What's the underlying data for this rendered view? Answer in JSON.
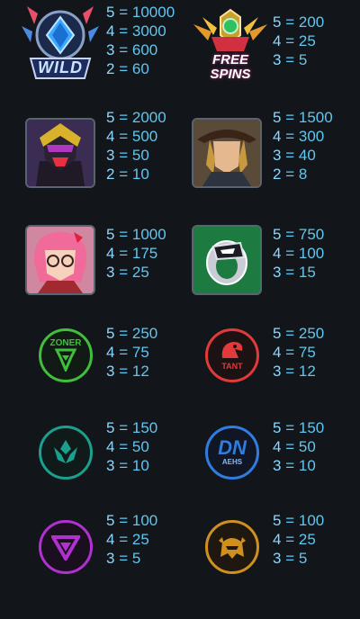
{
  "paytable": [
    {
      "symbol": "wild",
      "icon": "wild-logo-icon",
      "label": "WILD",
      "pays": [
        {
          "count": "5",
          "value": "10000"
        },
        {
          "count": "4",
          "value": "3000"
        },
        {
          "count": "3",
          "value": "600"
        },
        {
          "count": "2",
          "value": "60"
        }
      ]
    },
    {
      "symbol": "free-spins",
      "icon": "free-spins-logo-icon",
      "label": "FREE SPINS",
      "pays": [
        {
          "count": "5",
          "value": "200"
        },
        {
          "count": "4",
          "value": "25"
        },
        {
          "count": "3",
          "value": "5"
        }
      ]
    },
    {
      "symbol": "masked-hero",
      "icon": "masked-hero-portrait-icon",
      "pays": [
        {
          "count": "5",
          "value": "2000"
        },
        {
          "count": "4",
          "value": "500"
        },
        {
          "count": "3",
          "value": "50"
        },
        {
          "count": "2",
          "value": "10"
        }
      ]
    },
    {
      "symbol": "cowboy-hero",
      "icon": "cowboy-hero-portrait-icon",
      "pays": [
        {
          "count": "5",
          "value": "1500"
        },
        {
          "count": "4",
          "value": "300"
        },
        {
          "count": "3",
          "value": "40"
        },
        {
          "count": "2",
          "value": "8"
        }
      ]
    },
    {
      "symbol": "pink-hair-girl",
      "icon": "pink-hair-girl-portrait-icon",
      "pays": [
        {
          "count": "5",
          "value": "1000"
        },
        {
          "count": "4",
          "value": "175"
        },
        {
          "count": "3",
          "value": "25"
        }
      ]
    },
    {
      "symbol": "dragon-ring",
      "icon": "dragon-ring-icon",
      "pays": [
        {
          "count": "5",
          "value": "750"
        },
        {
          "count": "4",
          "value": "100"
        },
        {
          "count": "3",
          "value": "15"
        }
      ]
    },
    {
      "symbol": "zoner",
      "icon": "zoner-team-logo-icon",
      "label": "ZONER",
      "pays": [
        {
          "count": "5",
          "value": "250"
        },
        {
          "count": "4",
          "value": "75"
        },
        {
          "count": "3",
          "value": "12"
        }
      ]
    },
    {
      "symbol": "tant",
      "icon": "tant-team-logo-icon",
      "label": "TANT",
      "pays": [
        {
          "count": "5",
          "value": "250"
        },
        {
          "count": "4",
          "value": "75"
        },
        {
          "count": "3",
          "value": "12"
        }
      ]
    },
    {
      "symbol": "crest",
      "icon": "crest-team-logo-icon",
      "pays": [
        {
          "count": "5",
          "value": "150"
        },
        {
          "count": "4",
          "value": "50"
        },
        {
          "count": "3",
          "value": "10"
        }
      ]
    },
    {
      "symbol": "aehs",
      "icon": "aehs-team-logo-icon",
      "label": "DN",
      "sublabel": "AEHS",
      "pays": [
        {
          "count": "5",
          "value": "150"
        },
        {
          "count": "4",
          "value": "50"
        },
        {
          "count": "3",
          "value": "10"
        }
      ]
    },
    {
      "symbol": "v-emblem",
      "icon": "v-emblem-team-logo-icon",
      "pays": [
        {
          "count": "5",
          "value": "100"
        },
        {
          "count": "4",
          "value": "25"
        },
        {
          "count": "3",
          "value": "5"
        }
      ]
    },
    {
      "symbol": "helmet",
      "icon": "helmet-team-logo-icon",
      "pays": [
        {
          "count": "5",
          "value": "100"
        },
        {
          "count": "4",
          "value": "25"
        },
        {
          "count": "3",
          "value": "5"
        }
      ]
    }
  ],
  "separator": "=",
  "colors": {
    "background": "#12161b",
    "pay_text": "#5fc7f0",
    "zoner": "#3fbf3a",
    "tant": "#e03a3a",
    "crest": "#1aa08c",
    "aehs": "#2f7de0",
    "v_emblem": "#b030d0",
    "helmet": "#d09020"
  }
}
